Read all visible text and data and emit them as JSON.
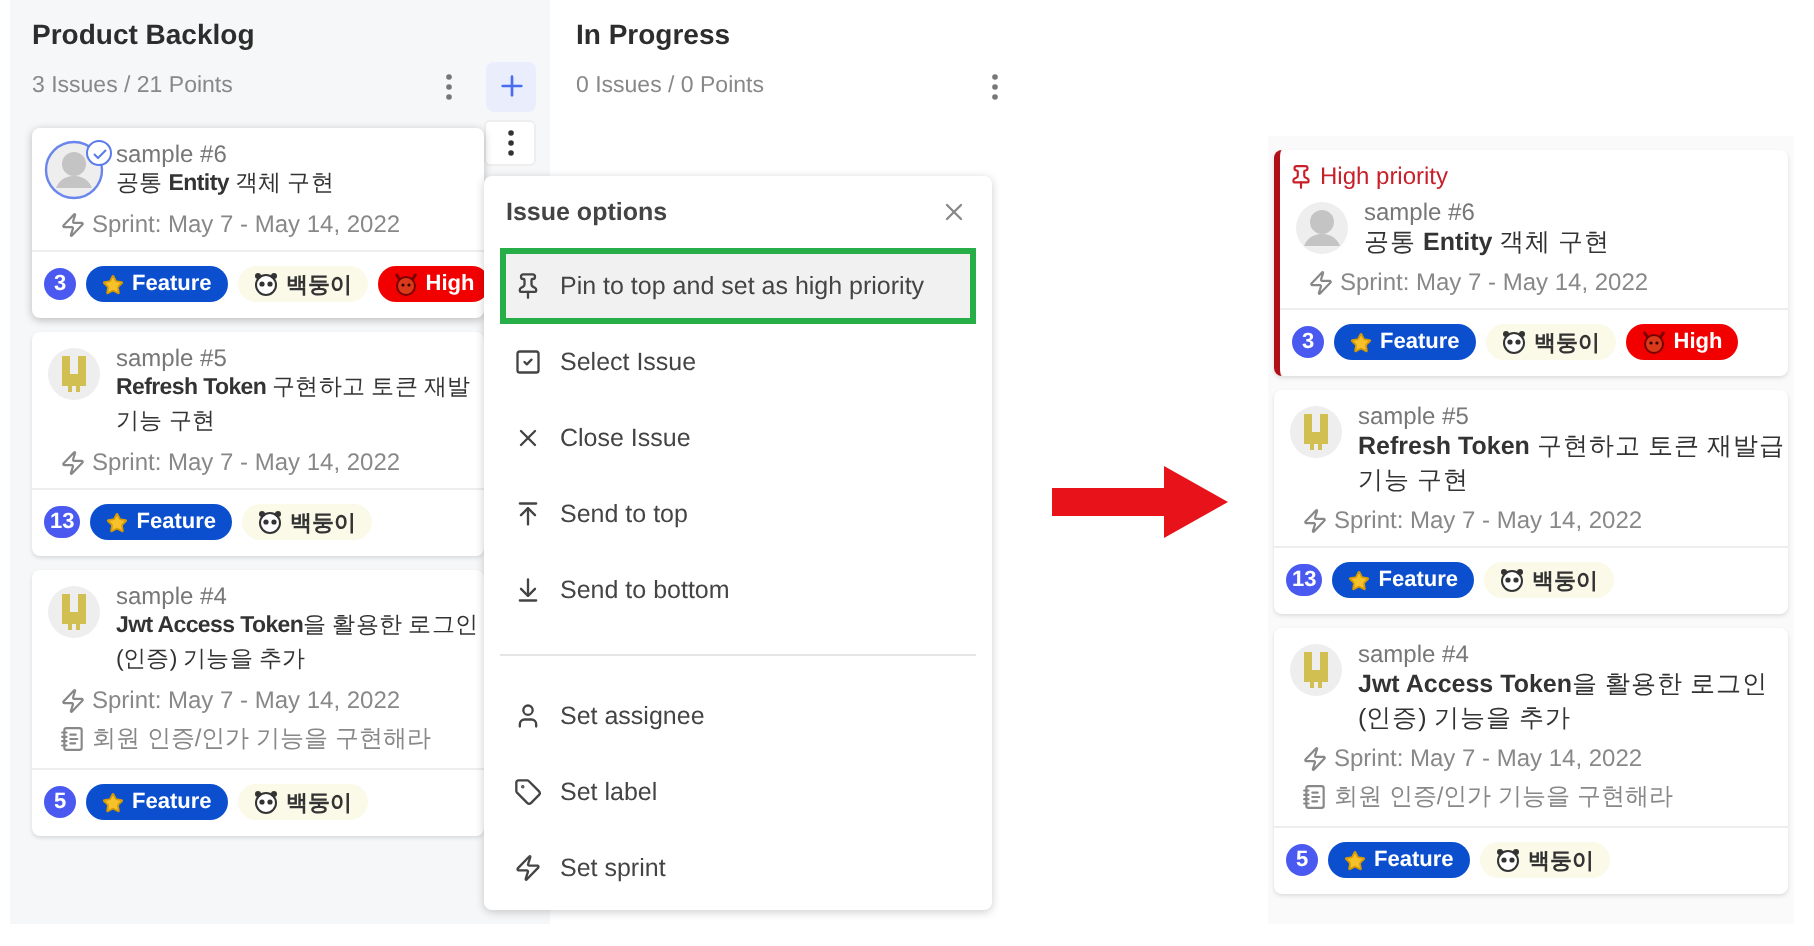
{
  "backlog": {
    "title": "Product Backlog",
    "summary": "3 Issues / 21 Points",
    "cards": [
      {
        "kind": "default",
        "avatar_checked": true,
        "menu_open": true,
        "pinned": false,
        "number": "sample #6",
        "title": [
          "공통 **Entity** 객체 구현"
        ],
        "sprint": "Sprint: May 7 - May 14, 2022",
        "points": "3",
        "tags": [
          {
            "kind": "feature",
            "label": "Feature"
          },
          {
            "kind": "assignee",
            "label": "백둥이"
          },
          {
            "kind": "priority",
            "label": "High"
          }
        ]
      },
      {
        "kind": "bunny",
        "avatar_checked": false,
        "menu_open": false,
        "pinned": false,
        "number": "sample #5",
        "title": [
          "**Refresh Token** 구현하고 토큰 재발",
          "기능 구현"
        ],
        "sprint": "Sprint: May 7 - May 14, 2022",
        "points": "13",
        "tags": [
          {
            "kind": "feature",
            "label": "Feature"
          },
          {
            "kind": "assignee",
            "label": "백둥이"
          }
        ]
      },
      {
        "kind": "bunny",
        "avatar_checked": false,
        "menu_open": false,
        "pinned": false,
        "number": "sample #4",
        "title": [
          "**Jwt Access Token**을 활용한 로그인",
          "(인증) 기능을 추가"
        ],
        "sprint": "Sprint: May 7 - May 14, 2022",
        "description": "회원 인증/인가 기능을 구현해라",
        "points": "5",
        "tags": [
          {
            "kind": "feature",
            "label": "Feature"
          },
          {
            "kind": "assignee",
            "label": "백둥이"
          }
        ]
      }
    ]
  },
  "in_progress": {
    "title": "In Progress",
    "summary": "0 Issues / 0 Points"
  },
  "issue_menu": {
    "title": "Issue options",
    "sections": [
      [
        {
          "label": "Pin to top and set as high priority",
          "selected": true
        },
        {
          "label": "Select Issue",
          "selected": false
        },
        {
          "label": "Close Issue",
          "selected": false
        },
        {
          "label": "Send to top",
          "selected": false
        },
        {
          "label": "Send to bottom",
          "selected": false
        }
      ],
      [
        {
          "label": "Set assignee",
          "selected": false
        },
        {
          "label": "Set label",
          "selected": false
        },
        {
          "label": "Set sprint",
          "selected": false
        }
      ]
    ]
  },
  "result": {
    "pinned_label": "High priority",
    "cards": [
      {
        "kind": "default",
        "avatar_checked": false,
        "menu_open": false,
        "pinned": true,
        "number": "sample #6",
        "title": [
          "공통 **Entity** 객체 구현"
        ],
        "sprint": "Sprint: May 7 - May 14, 2022",
        "points": "3",
        "tags": [
          {
            "kind": "feature",
            "label": "Feature"
          },
          {
            "kind": "assignee",
            "label": "백둥이"
          },
          {
            "kind": "priority",
            "label": "High"
          }
        ]
      },
      {
        "kind": "bunny",
        "avatar_checked": false,
        "menu_open": false,
        "pinned": false,
        "number": "sample #5",
        "title": [
          "**Refresh Token** 구현하고 토큰 재발급",
          "기능 구현"
        ],
        "sprint": "Sprint: May 7 - May 14, 2022",
        "points": "13",
        "tags": [
          {
            "kind": "feature",
            "label": "Feature"
          },
          {
            "kind": "assignee",
            "label": "백둥이"
          }
        ]
      },
      {
        "kind": "bunny",
        "avatar_checked": false,
        "menu_open": false,
        "pinned": false,
        "number": "sample #4",
        "title": [
          "**Jwt Access Token**을 활용한 로그인",
          "(인증) 기능을 추가"
        ],
        "sprint": "Sprint: May 7 - May 14, 2022",
        "description": "회원 인증/인가 기능을 구현해라",
        "points": "5",
        "tags": [
          {
            "kind": "feature",
            "label": "Feature"
          },
          {
            "kind": "assignee",
            "label": "백둥이"
          }
        ]
      }
    ]
  }
}
